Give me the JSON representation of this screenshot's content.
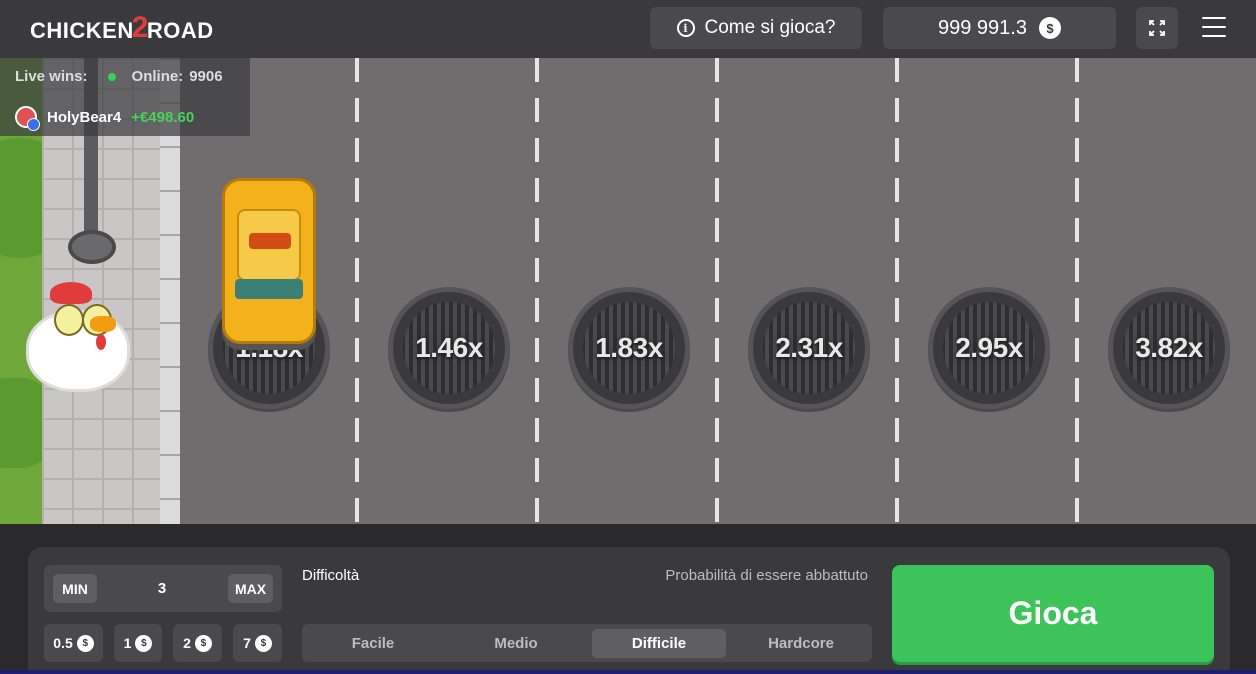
{
  "header": {
    "logo_left": "CHICKEN",
    "logo_mid": "2",
    "logo_right": "ROAD",
    "howto_label": "Come si gioca?",
    "balance": "999 991.3",
    "currency_symbol": "$"
  },
  "live": {
    "label": "Live wins:",
    "online_label": "Online:",
    "online_count": "9906",
    "last_winner": "HolyBear4",
    "last_win": "+€498.60"
  },
  "road": {
    "multipliers": [
      "1.18x",
      "1.46x",
      "1.83x",
      "2.31x",
      "2.95x",
      "3.82x"
    ]
  },
  "bet": {
    "min_label": "MIN",
    "max_label": "MAX",
    "value": "3",
    "chips": [
      "0.5",
      "1",
      "2",
      "7"
    ]
  },
  "difficulty": {
    "label": "Difficoltà",
    "probability_label": "Probabilità di essere abbattuto",
    "options": [
      "Facile",
      "Medio",
      "Difficile",
      "Hardcore"
    ],
    "selected": "Difficile"
  },
  "play_label": "Gioca"
}
